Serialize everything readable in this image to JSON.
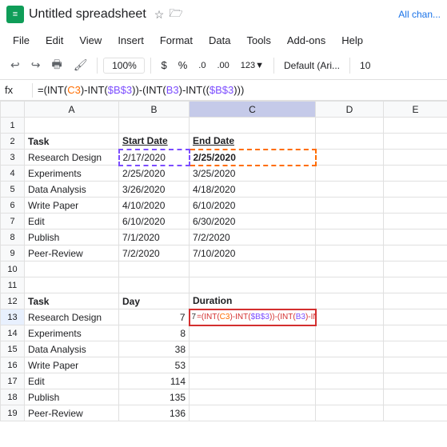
{
  "titleBar": {
    "icon": "S",
    "title": "Untitled spreadsheet",
    "starLabel": "☆",
    "folderLabel": "🗁",
    "allChanges": "All chan..."
  },
  "menu": {
    "items": [
      "File",
      "Edit",
      "View",
      "Insert",
      "Format",
      "Data",
      "Tools",
      "Add-ons",
      "Help"
    ]
  },
  "toolbar": {
    "undo": "↩",
    "redo": "↪",
    "print": "🖶",
    "paintFormat": "🖌",
    "zoom": "100%",
    "dollarSign": "$",
    "percent": "%",
    "decimalRemove": ".0",
    "decimalAdd": ".00",
    "moreFormats": "123",
    "fontName": "Default (Ari...",
    "fontSize": "10",
    "chevron1": "▾",
    "chevron2": "▾"
  },
  "formulaBar": {
    "cellRef": "fx",
    "formula": "=(INT(C3)-INT($B$3))-(INT(B3)-INT(($B$3)))"
  },
  "columns": {
    "headers": [
      "",
      "A",
      "B",
      "C",
      "D",
      "E"
    ]
  },
  "rows": [
    {
      "num": "1",
      "a": "",
      "b": "",
      "c": "",
      "d": "",
      "e": ""
    },
    {
      "num": "2",
      "a": "Task",
      "b": "Start Date",
      "c": "End Date",
      "d": "",
      "e": ""
    },
    {
      "num": "3",
      "a": "Research Design",
      "b": "2/17/2020",
      "c": "2/25/2020",
      "d": "",
      "e": ""
    },
    {
      "num": "4",
      "a": "Experiments",
      "b": "2/25/2020",
      "c": "3/25/2020",
      "d": "",
      "e": ""
    },
    {
      "num": "5",
      "a": "Data Analysis",
      "b": "3/26/2020",
      "c": "4/18/2020",
      "d": "",
      "e": ""
    },
    {
      "num": "6",
      "a": "Write Paper",
      "b": "4/10/2020",
      "c": "6/10/2020",
      "d": "",
      "e": ""
    },
    {
      "num": "7",
      "a": "Edit",
      "b": "6/10/2020",
      "c": "6/30/2020",
      "d": "",
      "e": ""
    },
    {
      "num": "8",
      "a": "Publish",
      "b": "7/1/2020",
      "c": "7/2/2020",
      "d": "",
      "e": ""
    },
    {
      "num": "9",
      "a": "Peer-Review",
      "b": "7/2/2020",
      "c": "7/10/2020",
      "d": "",
      "e": ""
    },
    {
      "num": "10",
      "a": "",
      "b": "",
      "c": "",
      "d": "",
      "e": ""
    },
    {
      "num": "11",
      "a": "",
      "b": "",
      "c": "",
      "d": "",
      "e": ""
    },
    {
      "num": "12",
      "a": "Task",
      "b": "Day",
      "c": "Duration",
      "d": "",
      "e": ""
    },
    {
      "num": "13",
      "a": "Research Design",
      "b": "7",
      "c": "=(INT(C3)-INT($B$3))-(INT(B3)-INT(($B$3)))",
      "d": "",
      "e": ""
    },
    {
      "num": "14",
      "a": "Experiments",
      "b": "8",
      "c": "",
      "d": "",
      "e": ""
    },
    {
      "num": "15",
      "a": "Data Analysis",
      "b": "38",
      "c": "",
      "d": "",
      "e": ""
    },
    {
      "num": "16",
      "a": "Write Paper",
      "b": "53",
      "c": "",
      "d": "",
      "e": ""
    },
    {
      "num": "17",
      "a": "Edit",
      "b": "114",
      "c": "",
      "d": "",
      "e": ""
    },
    {
      "num": "18",
      "a": "Publish",
      "b": "135",
      "c": "",
      "d": "",
      "e": ""
    },
    {
      "num": "19",
      "a": "Peer-Review",
      "b": "136",
      "c": "",
      "d": "",
      "e": ""
    }
  ]
}
